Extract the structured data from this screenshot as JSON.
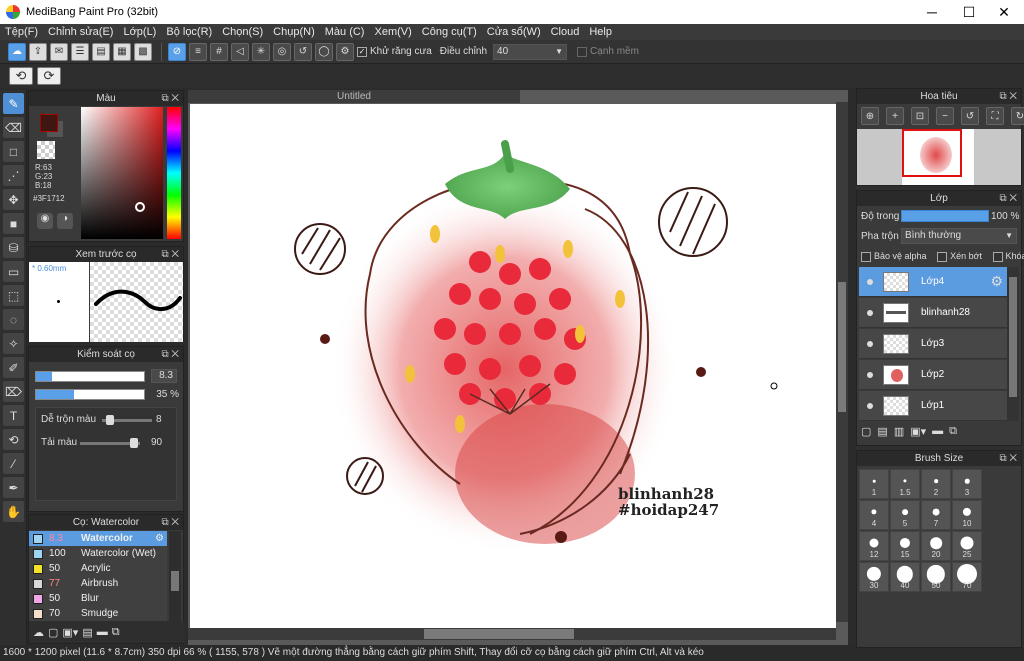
{
  "window": {
    "title": "MediBang Paint Pro (32bit)",
    "minimize": "─",
    "maximize": "☐",
    "close": "✕"
  },
  "menu": [
    "Tệp(F)",
    "Chỉnh sửa(E)",
    "Lớp(L)",
    "Bộ lọc(R)",
    "Chọn(S)",
    "Chụp(N)",
    "Màu (C)",
    "Xem(V)",
    "Công cụ(T)",
    "Cửa sổ(W)",
    "Cloud",
    "Help"
  ],
  "toolbar": {
    "antialias_label": "Khử răng cưa",
    "correction_label": "Điều chỉnh",
    "correction_value": "40",
    "soft_edge_label": "Cạnh mềm"
  },
  "nav": {
    "undo": "⟲",
    "redo": "⟳"
  },
  "color_panel": {
    "title": "Màu",
    "r": "R:63",
    "g": "G:23",
    "b": "B:18",
    "hex": "#3F1712",
    "current_color": "#3f1712"
  },
  "brush_preview": {
    "title": "Xem trước cọ",
    "size": "* 0.60mm"
  },
  "brush_control": {
    "title": "Kiểm soát cọ",
    "size_value": "8.3",
    "opacity_value": "35 %",
    "mix_label": "Dễ trộn màu",
    "mix_value": "8",
    "reload_label": "Tải màu",
    "reload_value": "90"
  },
  "brush_list": {
    "title": "Cọ: Watercolor",
    "items": [
      {
        "value": "8.3",
        "name": "Watercolor",
        "color": "#9fd4f2"
      },
      {
        "value": "100",
        "name": "Watercolor (Wet)",
        "color": "#9fd4f2"
      },
      {
        "value": "50",
        "name": "Acrylic",
        "color": "#f4e12a"
      },
      {
        "value": "77",
        "name": "Airbrush",
        "color": "#d8d8d8"
      },
      {
        "value": "50",
        "name": "Blur",
        "color": "#f1a6e6"
      },
      {
        "value": "70",
        "name": "Smudge",
        "color": "#f4e0c8"
      }
    ]
  },
  "canvas": {
    "tab": "Untitled",
    "signature1": "blinhanh28",
    "signature2": "#hoidap247"
  },
  "navigator": {
    "title": "Hoa tiêu"
  },
  "layers": {
    "title": "Lớp",
    "opacity_label": "Độ trong",
    "opacity_value": "100 %",
    "opacity_fraction": 1.0,
    "blend_label": "Pha trộn",
    "blend_value": "Bình thường",
    "protect_alpha": "Bảo vệ alpha",
    "clip": "Xén bớt",
    "lock": "Khóa",
    "items": [
      {
        "name": "Lớp4"
      },
      {
        "name": "blinhanh28"
      },
      {
        "name": "Lớp3"
      },
      {
        "name": "Lớp2"
      },
      {
        "name": "Lớp1"
      }
    ]
  },
  "brush_size": {
    "title": "Brush Size",
    "sizes": [
      "1",
      "1.5",
      "2",
      "3",
      "4",
      "5",
      "7",
      "10",
      "12",
      "15",
      "20",
      "25",
      "30",
      "40",
      "50",
      "70"
    ]
  },
  "status": {
    "text": "1600 * 1200 pixel   (11.6 * 8.7cm)   350 dpi   66 %   ( 1155, 578 )   Vẽ một đường thẳng bằng cách giữ phím Shift, Thay đổi cỡ cọ bằng cách giữ phím Ctrl, Alt và kéo"
  }
}
